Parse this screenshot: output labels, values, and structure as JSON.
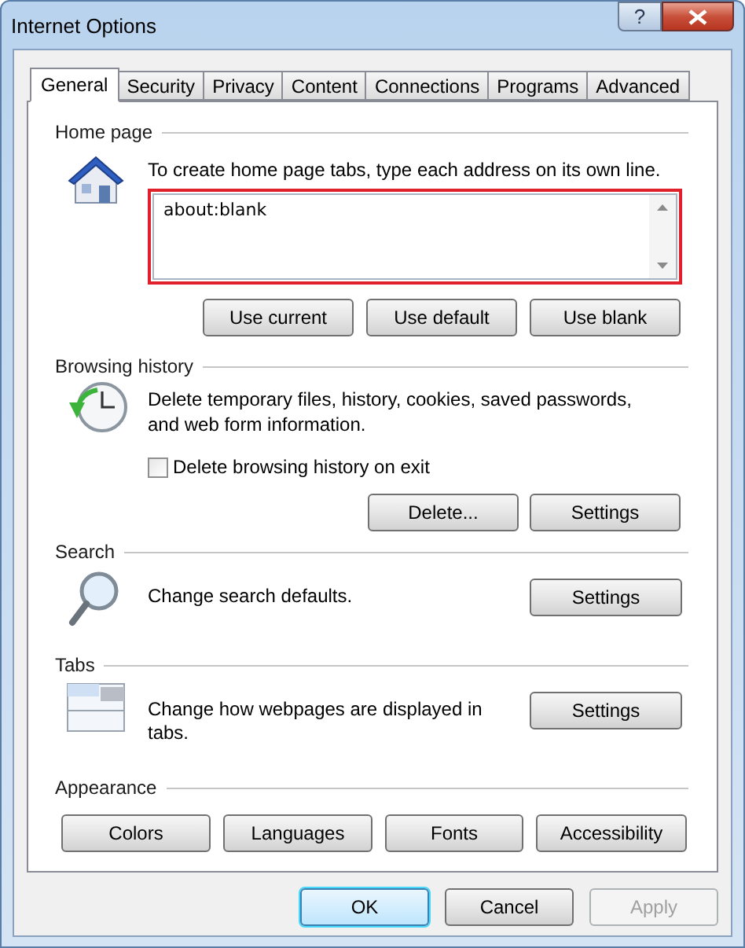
{
  "window": {
    "title": "Internet Options",
    "help_button": "?"
  },
  "tabs": [
    {
      "label": "General",
      "selected": true
    },
    {
      "label": "Security",
      "selected": false
    },
    {
      "label": "Privacy",
      "selected": false
    },
    {
      "label": "Content",
      "selected": false
    },
    {
      "label": "Connections",
      "selected": false
    },
    {
      "label": "Programs",
      "selected": false
    },
    {
      "label": "Advanced",
      "selected": false
    }
  ],
  "home_page": {
    "heading": "Home page",
    "description": "To create home page tabs, type each address on its own line.",
    "field": {
      "value": "about:blank",
      "highlighted": true
    },
    "buttons": [
      "Use current",
      "Use default",
      "Use blank"
    ]
  },
  "browsing_history": {
    "heading": "Browsing history",
    "description": "Delete temporary files, history, cookies, saved passwords, and web form information.",
    "checkbox": {
      "label": "Delete browsing history on exit",
      "checked": false
    },
    "buttons": [
      "Delete...",
      "Settings"
    ]
  },
  "search": {
    "heading": "Search",
    "description": "Change search defaults.",
    "button": "Settings"
  },
  "tabs_section": {
    "heading": "Tabs",
    "description": "Change how webpages are displayed in tabs.",
    "button": "Settings"
  },
  "appearance": {
    "heading": "Appearance",
    "buttons": [
      "Colors",
      "Languages",
      "Fonts",
      "Accessibility"
    ]
  },
  "dialog_buttons": [
    {
      "label": "OK",
      "default": true,
      "disabled": false
    },
    {
      "label": "Cancel",
      "default": false,
      "disabled": false
    },
    {
      "label": "Apply",
      "default": false,
      "disabled": true
    }
  ]
}
